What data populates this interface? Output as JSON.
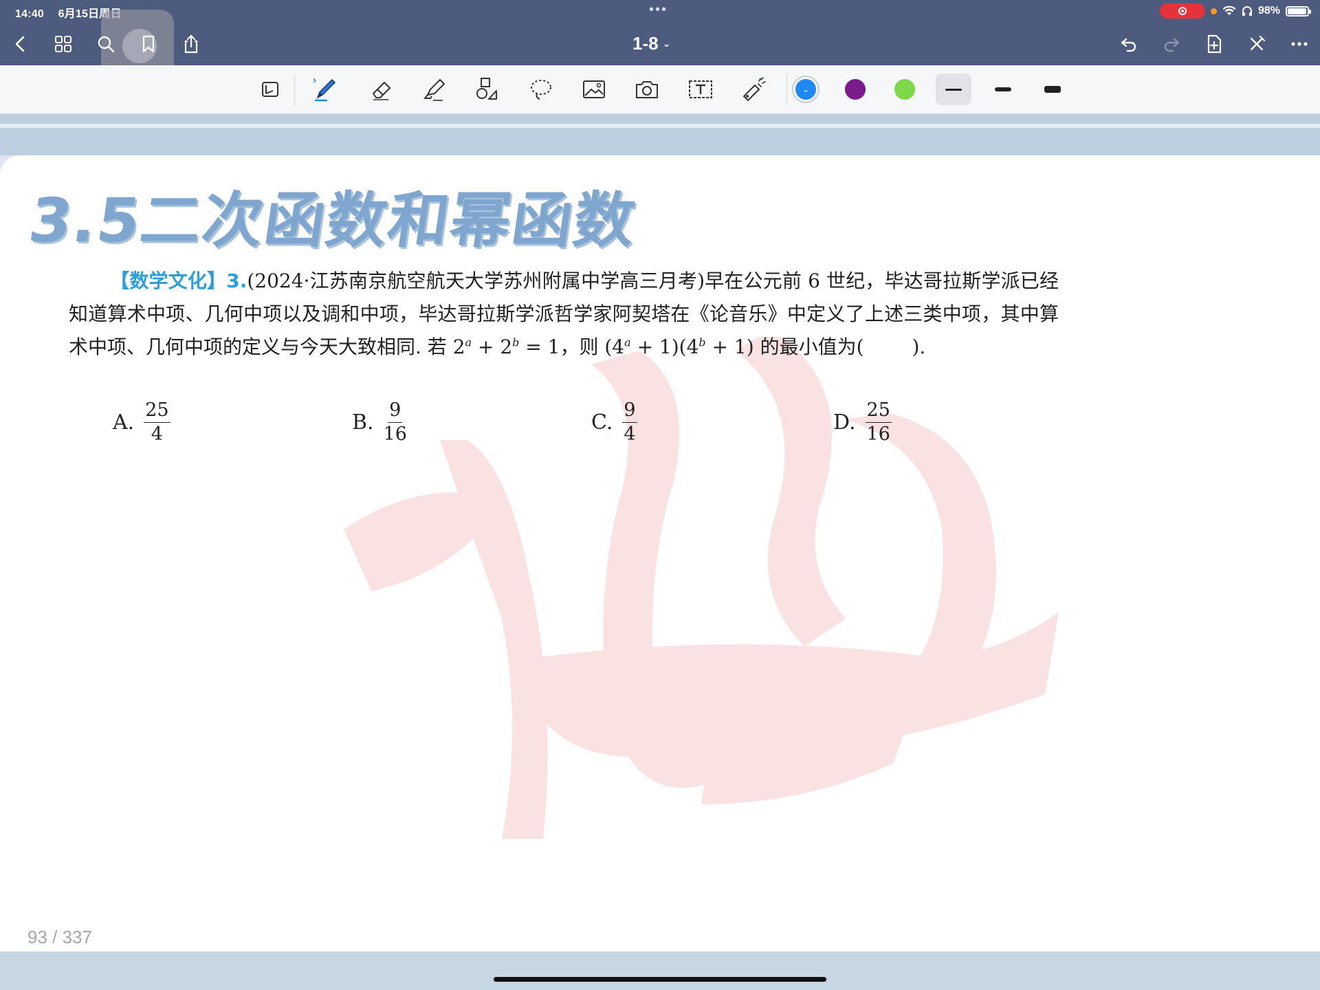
{
  "status_bar": {
    "time": "14:40",
    "date": "6月15日周日",
    "battery": "98%",
    "battery_level": 0.98
  },
  "top_bar": {
    "doc_title": "1-8"
  },
  "toolbar": {
    "colors": [
      {
        "name": "blue",
        "hex": "#1e88f3",
        "selected": true
      },
      {
        "name": "purple",
        "hex": "#7b1a8c",
        "selected": false
      },
      {
        "name": "green",
        "hex": "#7fd84a",
        "selected": false
      }
    ],
    "thickness_selected": "thin"
  },
  "document": {
    "chapter_title": "3.5二次函数和幂函数",
    "problem": {
      "tag": "【数学文化】",
      "number": "3.",
      "source": "(2024·江苏南京航空航天大学苏州附属中学高三月考)",
      "text_1": "早在公元前 6 世纪，毕达哥拉斯学派已经知道算术中项、几何中项以及调和中项，毕达哥拉斯学派哲学家阿契塔在《论音乐》中定义了上述三类中项，其中算术中项、几何中项的定义与今天大致相同. 若 2",
      "exp_a": "a",
      "text_2": " + 2",
      "exp_b": "b",
      "text_3": " = 1，则 (4",
      "text_4": " + 1)(4",
      "text_5": " + 1) 的最小值为(",
      "text_6": ")."
    },
    "choices": [
      {
        "label": "A.",
        "num": "25",
        "den": "4"
      },
      {
        "label": "B.",
        "num": "9",
        "den": "16"
      },
      {
        "label": "C.",
        "num": "9",
        "den": "4"
      },
      {
        "label": "D.",
        "num": "25",
        "den": "16"
      }
    ],
    "page_indicator": "93 / 337"
  }
}
